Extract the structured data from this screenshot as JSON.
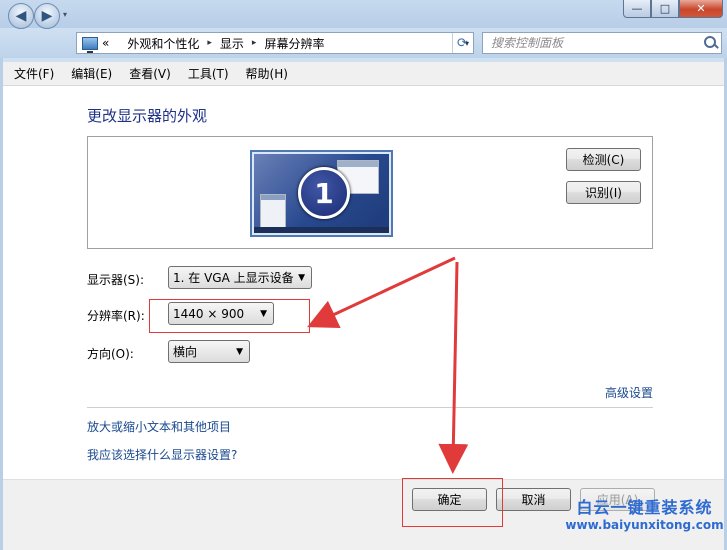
{
  "window": {
    "minimize_glyph": "—",
    "maximize_glyph": "□",
    "close_glyph": "✕"
  },
  "nav": {
    "back_glyph": "◀",
    "forward_glyph": "▶",
    "dropdown_glyph": "▾",
    "refresh_glyph": "⟳"
  },
  "address": {
    "overflow": "«",
    "separator": "▸",
    "crumbs": [
      "外观和个性化",
      "显示",
      "屏幕分辨率"
    ],
    "dropdown_glyph": "▾"
  },
  "search": {
    "placeholder": "搜索控制面板"
  },
  "menu": {
    "items": [
      "文件(F)",
      "编辑(E)",
      "查看(V)",
      "工具(T)",
      "帮助(H)"
    ]
  },
  "page": {
    "title": "更改显示器的外观",
    "monitor_number": "1",
    "detect_label": "检测(C)",
    "identify_label": "识别(I)"
  },
  "fields": {
    "display_label": "显示器(S):",
    "display_value": "1. 在 VGA 上显示设备",
    "resolution_label": "分辨率(R):",
    "resolution_value": "1440 × 900",
    "orientation_label": "方向(O):",
    "orientation_value": "横向",
    "combo_arrow": "▼"
  },
  "links": {
    "advanced": "高级设置",
    "text_size": "放大或缩小文本和其他项目",
    "which_settings": "我应该选择什么显示器设置?"
  },
  "footer": {
    "ok_label": "确定",
    "cancel_label": "取消",
    "apply_label": "应用(A)"
  },
  "watermark": {
    "logo": "白云一键重装系统",
    "url": "www.baiyunxitong.com"
  },
  "colors": {
    "annotation_red": "#e03a3a",
    "link_blue": "#1a4a8f",
    "title_blue": "#1e3287"
  }
}
